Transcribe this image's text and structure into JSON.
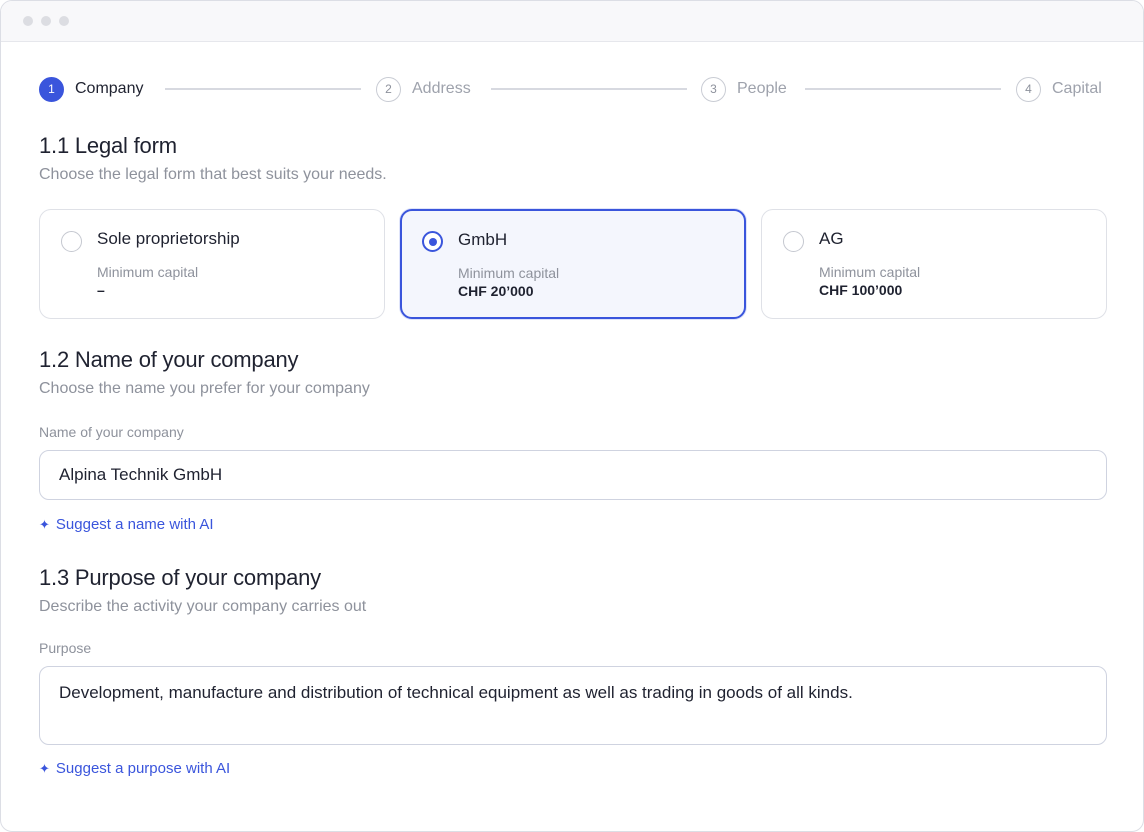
{
  "stepper": {
    "steps": [
      {
        "number": "1",
        "label": "Company",
        "active": true
      },
      {
        "number": "2",
        "label": "Address",
        "active": false
      },
      {
        "number": "3",
        "label": "People",
        "active": false
      },
      {
        "number": "4",
        "label": "Capital",
        "active": false
      }
    ]
  },
  "legal_form": {
    "title": "1.1 Legal form",
    "subtitle": "Choose the legal form that best suits your needs.",
    "options": [
      {
        "name": "Sole proprietorship",
        "cap_label": "Minimum capital",
        "cap_value": "–",
        "selected": false
      },
      {
        "name": "GmbH",
        "cap_label": "Minimum capital",
        "cap_value": "CHF 20’000",
        "selected": true
      },
      {
        "name": "AG",
        "cap_label": "Minimum capital",
        "cap_value": "CHF 100’000",
        "selected": false
      }
    ]
  },
  "company_name": {
    "title": "1.2 Name of your company",
    "subtitle": "Choose the name you prefer for your company",
    "field_label": "Name of your company",
    "value": "Alpina Technik GmbH",
    "ai_link": "Suggest a name with AI"
  },
  "purpose": {
    "title": "1.3 Purpose of your company",
    "subtitle": "Describe the activity your company carries out",
    "field_label": "Purpose",
    "value": "Development, manufacture and distribution of technical equipment as well as trading in goods of all kinds.",
    "ai_link": "Suggest a purpose with AI"
  },
  "colors": {
    "accent": "#3a55dc",
    "muted_text": "#8e929c",
    "border": "#dfe1e7"
  },
  "icons": {
    "ai": "sparkle-icon"
  }
}
